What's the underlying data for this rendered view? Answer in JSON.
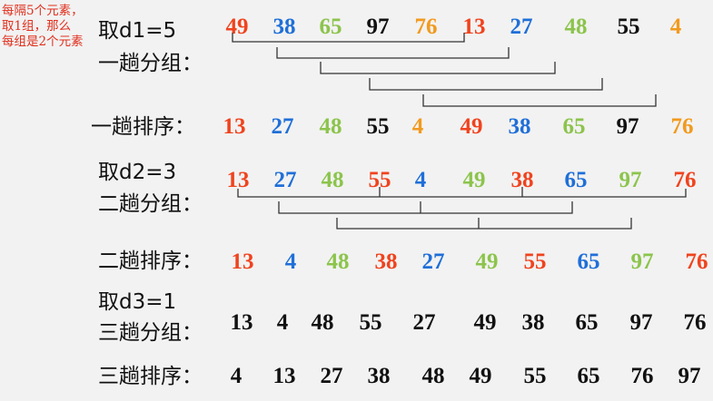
{
  "note": [
    "每隔5个元素，",
    "取1组，那么",
    "每组是2个元素"
  ],
  "labels": {
    "d1": "取d1=5",
    "pass1_group": "一趟分组：",
    "pass1_sort": "一趟排序：",
    "d2": "取d2=3",
    "pass2_group": "二趟分组：",
    "pass2_sort": "二趟排序：",
    "d3": "取d3=1",
    "pass3_group": "三趟分组：",
    "pass3_sort": "三趟排序："
  },
  "rows": {
    "initial": [
      "49",
      "38",
      "65",
      "97",
      "76",
      "13",
      "27",
      "48",
      "55",
      "4"
    ],
    "pass1_sorted": [
      "13",
      "27",
      "48",
      "55",
      "4",
      "49",
      "38",
      "65",
      "97",
      "76"
    ],
    "pass2_group": [
      "13",
      "27",
      "48",
      "55",
      "4",
      "49",
      "38",
      "65",
      "97",
      "76"
    ],
    "pass2_sorted": [
      "13",
      "4",
      "48",
      "38",
      "27",
      "49",
      "55",
      "65",
      "97",
      "76"
    ],
    "pass3_group": [
      "13",
      "4",
      "48",
      "55",
      "27",
      "49",
      "38",
      "65",
      "97",
      "76"
    ],
    "pass3_sorted": [
      "4",
      "13",
      "27",
      "38",
      "48",
      "49",
      "55",
      "65",
      "76",
      "97"
    ]
  },
  "colors": {
    "red": "#f0431e",
    "blue": "#1f6fd8",
    "green": "#8cc44c",
    "black": "#111111",
    "orange": "#f29a1e",
    "note": "#e0301e",
    "background": "#f2f2f2"
  }
}
